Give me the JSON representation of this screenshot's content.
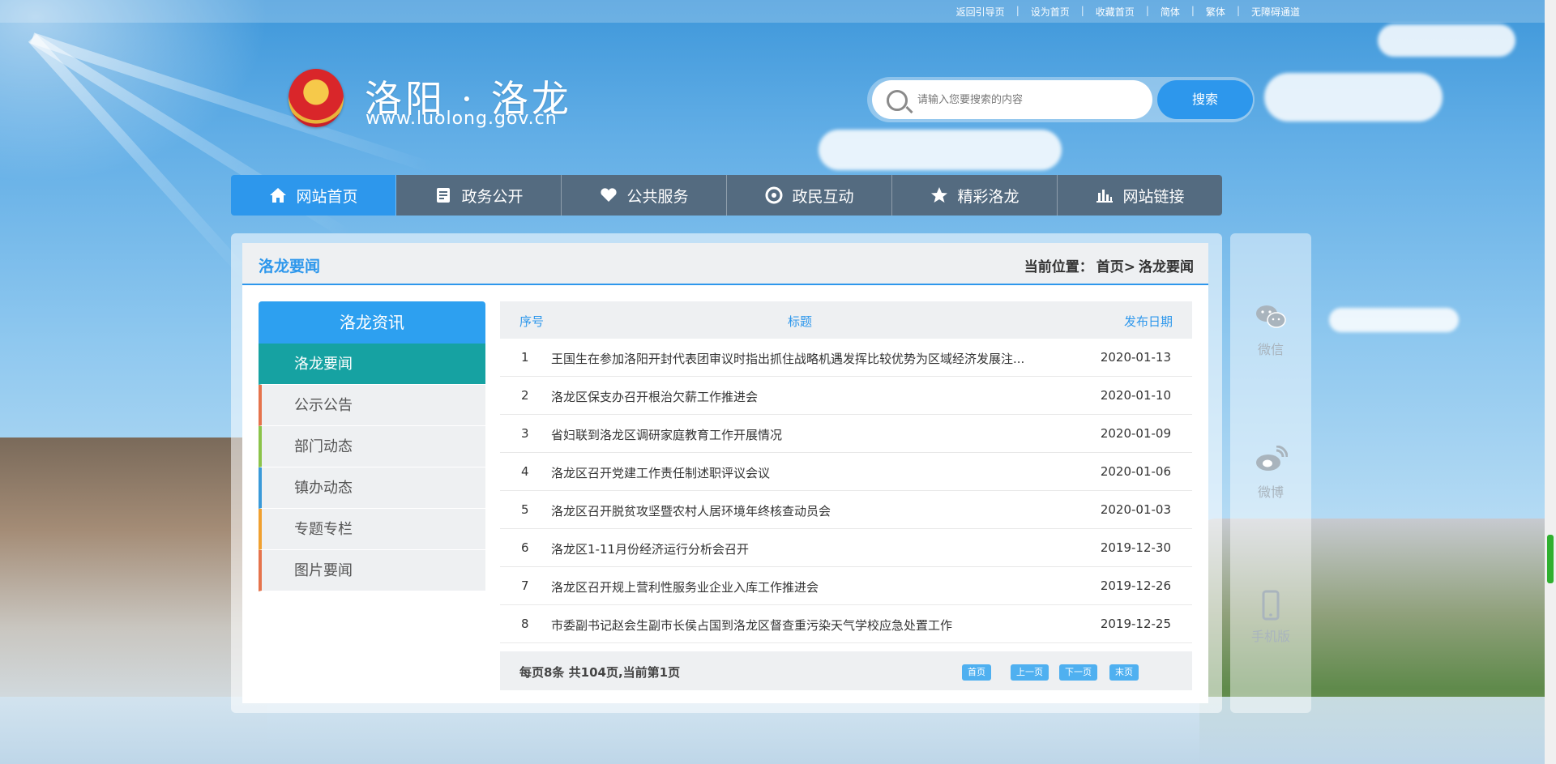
{
  "top_links": [
    "返回引导页",
    "设为首页",
    "收藏首页",
    "简体",
    "繁体",
    "无障碍通道"
  ],
  "header": {
    "title": "洛阳 · 洛龙",
    "url": "www.luolong.gov.cn"
  },
  "search": {
    "placeholder": "请输入您要搜索的内容",
    "button": "搜索"
  },
  "nav": [
    {
      "label": "网站首页",
      "icon": "home-icon",
      "active": true
    },
    {
      "label": "政务公开",
      "icon": "document-icon",
      "active": false
    },
    {
      "label": "公共服务",
      "icon": "heart-hand-icon",
      "active": false
    },
    {
      "label": "政民互动",
      "icon": "interaction-icon",
      "active": false
    },
    {
      "label": "精彩洛龙",
      "icon": "star-icon",
      "active": false
    },
    {
      "label": "网站链接",
      "icon": "bar-chart-icon",
      "active": false
    }
  ],
  "panel": {
    "title": "洛龙要闻",
    "breadcrumb": [
      "当前位置：",
      "首页>",
      "洛龙要闻"
    ]
  },
  "sidebar": {
    "heading": "洛龙资讯",
    "items": [
      {
        "label": "洛龙要闻",
        "active": true,
        "accent": "#16a2a2"
      },
      {
        "label": "公示公告",
        "active": false,
        "accent": "#e5734c"
      },
      {
        "label": "部门动态",
        "active": false,
        "accent": "#8bc34a"
      },
      {
        "label": "镇办动态",
        "active": false,
        "accent": "#3a9ad9"
      },
      {
        "label": "专题专栏",
        "active": false,
        "accent": "#f0a030"
      },
      {
        "label": "图片要闻",
        "active": false,
        "accent": "#e5734c"
      }
    ]
  },
  "list": {
    "headers": {
      "num": "序号",
      "title": "标题",
      "date": "发布日期"
    },
    "rows": [
      {
        "num": "1",
        "title": "王国生在参加洛阳开封代表团审议时指出抓住战略机遇发挥比较优势为区域经济发展注...",
        "date": "2020-01-13"
      },
      {
        "num": "2",
        "title": "洛龙区保支办召开根治欠薪工作推进会",
        "date": "2020-01-10"
      },
      {
        "num": "3",
        "title": "省妇联到洛龙区调研家庭教育工作开展情况",
        "date": "2020-01-09"
      },
      {
        "num": "4",
        "title": "洛龙区召开党建工作责任制述职评议会议",
        "date": "2020-01-06"
      },
      {
        "num": "5",
        "title": "洛龙区召开脱贫攻坚暨农村人居环境年终核查动员会",
        "date": "2020-01-03"
      },
      {
        "num": "6",
        "title": "洛龙区1-11月份经济运行分析会召开",
        "date": "2019-12-30"
      },
      {
        "num": "7",
        "title": "洛龙区召开规上营利性服务业企业入库工作推进会",
        "date": "2019-12-26"
      },
      {
        "num": "8",
        "title": "市委副书记赵会生副市长侯占国到洛龙区督查重污染天气学校应急处置工作",
        "date": "2019-12-25"
      }
    ],
    "pager": {
      "info": "每页8条 共104页,当前第1页",
      "first": "首页",
      "prev": "上一页",
      "next": "下一页",
      "last": "末页"
    }
  },
  "float": {
    "wechat": "微信",
    "weibo": "微博",
    "mobile": "手机版"
  },
  "colors": {
    "accent": "#2d97ec",
    "nav_bg": "#546b80",
    "sidebar_active": "#16a2a2"
  }
}
